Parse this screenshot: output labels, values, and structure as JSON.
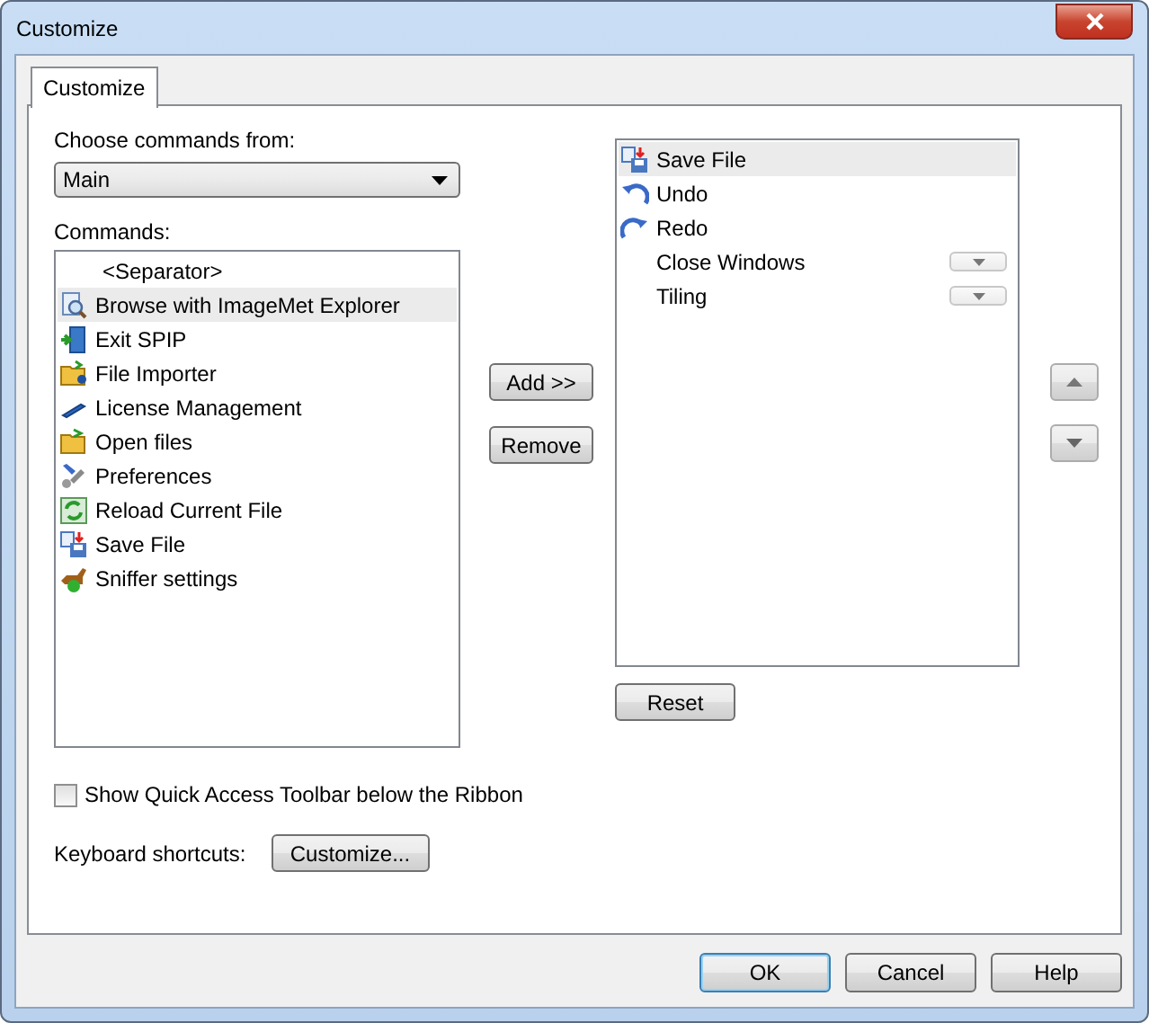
{
  "window": {
    "title": "Customize"
  },
  "tabs": [
    {
      "label": "Customize",
      "selected": true
    }
  ],
  "source": {
    "label": "Choose commands from:",
    "value": "Main"
  },
  "commands": {
    "label": "Commands:",
    "items": [
      {
        "label": "<Separator>",
        "kind": "separator",
        "selected": false
      },
      {
        "label": "Browse with ImageMet Explorer",
        "kind": "command",
        "selected": true
      },
      {
        "label": "Exit SPIP",
        "kind": "command",
        "selected": false
      },
      {
        "label": "File Importer",
        "kind": "command",
        "selected": false
      },
      {
        "label": "License Management",
        "kind": "command",
        "selected": false
      },
      {
        "label": "Open files",
        "kind": "command",
        "selected": false
      },
      {
        "label": "Preferences",
        "kind": "command",
        "selected": false
      },
      {
        "label": "Reload Current File",
        "kind": "command",
        "selected": false
      },
      {
        "label": "Save File",
        "kind": "command",
        "selected": false
      },
      {
        "label": "Sniffer settings",
        "kind": "command",
        "selected": false
      }
    ]
  },
  "add_button": "Add >>",
  "remove_button": "Remove",
  "toolbar": {
    "items": [
      {
        "label": "Save File",
        "kind": "command",
        "selected": true
      },
      {
        "label": "Undo",
        "kind": "command",
        "selected": false
      },
      {
        "label": "Redo",
        "kind": "command",
        "selected": false
      },
      {
        "label": "Close Windows",
        "kind": "menu",
        "selected": false
      },
      {
        "label": "Tiling",
        "kind": "menu",
        "selected": false
      }
    ]
  },
  "reset_button": "Reset",
  "below_ribbon": {
    "label": "Show Quick Access Toolbar below the Ribbon",
    "checked": false
  },
  "shortcuts": {
    "label": "Keyboard shortcuts:",
    "button": "Customize..."
  },
  "buttons": [
    {
      "label": "OK",
      "default": true
    },
    {
      "label": "Cancel",
      "default": false
    },
    {
      "label": "Help",
      "default": false
    }
  ]
}
